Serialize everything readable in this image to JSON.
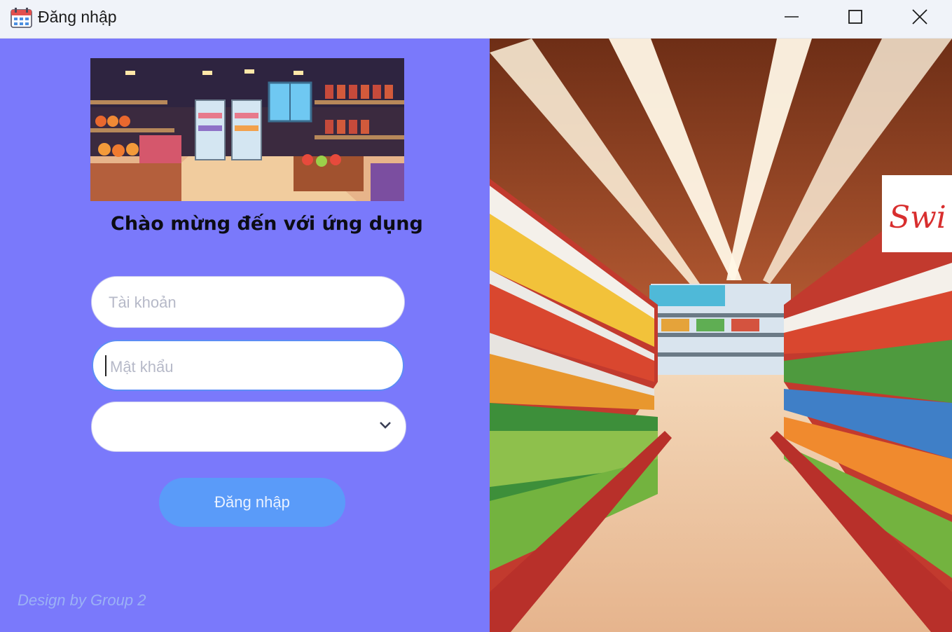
{
  "window": {
    "title": "Đăng nhập",
    "icon": "calendar-app-icon"
  },
  "login": {
    "welcome": "Chào mừng đến với ứng dụng",
    "username_placeholder": "Tài khoản",
    "password_placeholder": "Mật khẩu",
    "role_value": "",
    "submit_label": "Đăng nhập",
    "credit": "Design by Group 2"
  },
  "theme": {
    "panel_bg": "#7a79fb",
    "button_bg": "#5a9bf9",
    "focus_border": "#5d8df5"
  },
  "images": {
    "banner": "pixel-art-grocery-store-illustration",
    "side": "supermarket-aisle-photo"
  }
}
